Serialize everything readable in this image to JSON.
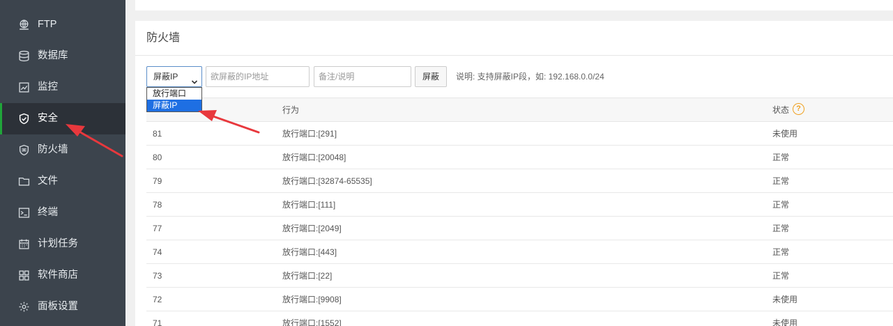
{
  "sidebar": {
    "items": [
      {
        "label": "FTP",
        "icon": "ftp-globe-icon"
      },
      {
        "label": "数据库",
        "icon": "database-icon"
      },
      {
        "label": "监控",
        "icon": "monitor-chart-icon"
      },
      {
        "label": "安全",
        "icon": "shield-check-icon"
      },
      {
        "label": "防火墙",
        "icon": "firewall-shield-icon"
      },
      {
        "label": "文件",
        "icon": "folder-icon"
      },
      {
        "label": "终端",
        "icon": "terminal-icon"
      },
      {
        "label": "计划任务",
        "icon": "calendar-icon"
      },
      {
        "label": "软件商店",
        "icon": "apps-grid-icon"
      },
      {
        "label": "面板设置",
        "icon": "gear-icon"
      }
    ],
    "active_index": 3,
    "accent_color": "#20a53a"
  },
  "panel": {
    "title": "防火墙"
  },
  "toolbar": {
    "select_value": "屏蔽IP",
    "select_options": [
      "放行端口",
      "屏蔽IP"
    ],
    "ip_placeholder": "欲屏蔽的IP地址",
    "note_placeholder": "备注/说明",
    "submit_label": "屏蔽",
    "hint": "说明: 支持屏蔽IP段，如: 192.168.0.0/24"
  },
  "table": {
    "headers": {
      "action": "行为",
      "status": "状态"
    },
    "rows": [
      {
        "id": "81",
        "action": "放行端口:[291]",
        "status": "未使用"
      },
      {
        "id": "80",
        "action": "放行端口:[20048]",
        "status": "正常"
      },
      {
        "id": "79",
        "action": "放行端口:[32874-65535]",
        "status": "正常"
      },
      {
        "id": "78",
        "action": "放行端口:[111]",
        "status": "正常"
      },
      {
        "id": "77",
        "action": "放行端口:[2049]",
        "status": "正常"
      },
      {
        "id": "74",
        "action": "放行端口:[443]",
        "status": "正常"
      },
      {
        "id": "73",
        "action": "放行端口:[22]",
        "status": "正常"
      },
      {
        "id": "72",
        "action": "放行端口:[9908]",
        "status": "未使用"
      },
      {
        "id": "71",
        "action": "放行端口:[1552]",
        "status": "未使用"
      }
    ]
  },
  "annotation_color": "#e8383d"
}
